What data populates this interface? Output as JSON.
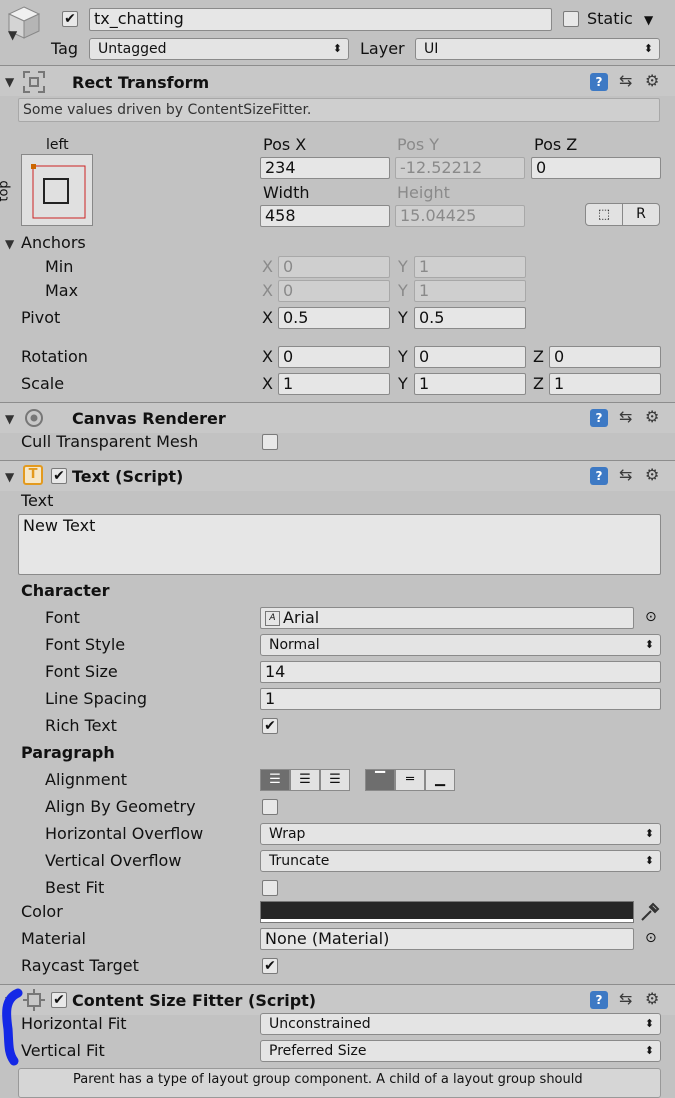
{
  "header": {
    "object_name": "tx_chatting",
    "active_checked": true,
    "static_label": "Static",
    "tag_label": "Tag",
    "tag_value": "Untagged",
    "layer_label": "Layer",
    "layer_value": "UI"
  },
  "rect_transform": {
    "title": "Rect Transform",
    "notice": "Some values driven by ContentSizeFitter.",
    "anchor_h": "left",
    "anchor_v": "top",
    "pos_x_label": "Pos X",
    "pos_x": "234",
    "pos_y_label": "Pos Y",
    "pos_y": "-12.52212",
    "pos_z_label": "Pos Z",
    "pos_z": "0",
    "width_label": "Width",
    "width": "458",
    "height_label": "Height",
    "height": "15.04425",
    "r_button": "R",
    "anchors_label": "Anchors",
    "min_label": "Min",
    "min_x": "0",
    "min_y": "1",
    "max_label": "Max",
    "max_x": "0",
    "max_y": "1",
    "pivot_label": "Pivot",
    "pivot_x": "0.5",
    "pivot_y": "0.5",
    "rotation_label": "Rotation",
    "rot_x": "0",
    "rot_y": "0",
    "rot_z": "0",
    "scale_label": "Scale",
    "scale_x": "1",
    "scale_y": "1",
    "scale_z": "1",
    "axis_x": "X",
    "axis_y": "Y",
    "axis_z": "Z"
  },
  "canvas_renderer": {
    "title": "Canvas Renderer",
    "cull_label": "Cull Transparent Mesh",
    "cull_checked": false
  },
  "text_script": {
    "title": "Text (Script)",
    "text_label": "Text",
    "text_value": "New Text",
    "character_label": "Character",
    "font_label": "Font",
    "font_value": "Arial",
    "font_style_label": "Font Style",
    "font_style_value": "Normal",
    "font_size_label": "Font Size",
    "font_size_value": "14",
    "line_spacing_label": "Line Spacing",
    "line_spacing_value": "1",
    "rich_text_label": "Rich Text",
    "rich_text_checked": true,
    "paragraph_label": "Paragraph",
    "alignment_label": "Alignment",
    "align_by_geometry_label": "Align By Geometry",
    "h_overflow_label": "Horizontal Overflow",
    "h_overflow_value": "Wrap",
    "v_overflow_label": "Vertical Overflow",
    "v_overflow_value": "Truncate",
    "best_fit_label": "Best Fit",
    "color_label": "Color",
    "color_value": "#262626",
    "material_label": "Material",
    "material_value": "None (Material)",
    "raycast_label": "Raycast Target",
    "raycast_checked": true
  },
  "content_size_fitter": {
    "title": "Content Size Fitter (Script)",
    "h_fit_label": "Horizontal Fit",
    "h_fit_value": "Unconstrained",
    "v_fit_label": "Vertical Fit",
    "v_fit_value": "Preferred Size",
    "info_text": "Parent has a type of layout group component. A child of a layout group should"
  },
  "colors": {
    "panel_bg": "#c2c2c2",
    "annotation_blue": "#1428e6"
  }
}
